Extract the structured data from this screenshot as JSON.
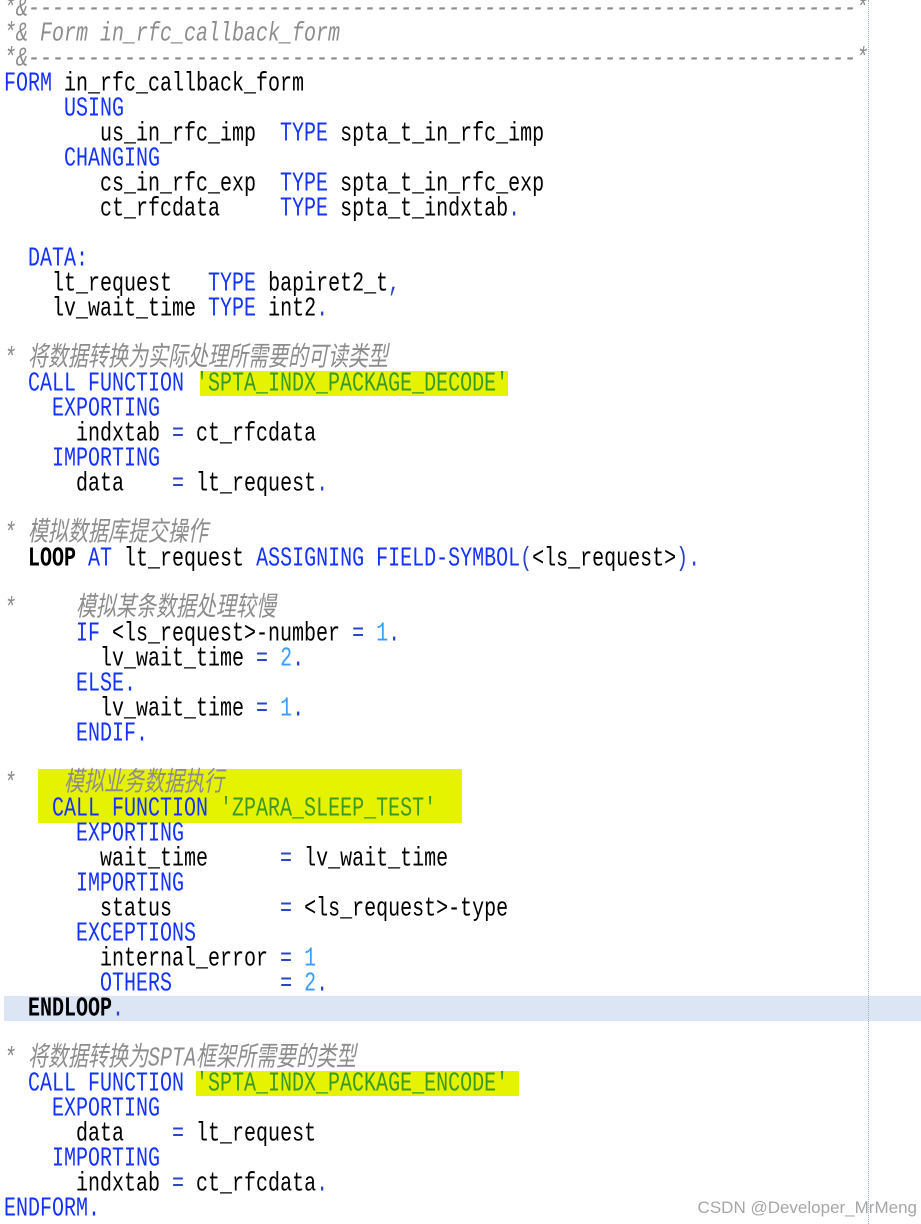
{
  "editor": {
    "current_line": 41,
    "lines": [
      [
        {
          "cm": "*&---------------------------------------------------------------------*"
        }
      ],
      [
        {
          "cm": "*& Form in_rfc_callback_form"
        }
      ],
      [
        {
          "cm": "*&---------------------------------------------------------------------*"
        }
      ],
      [
        {
          "kw": "FORM"
        },
        {
          "id": " in_rfc_callback_form"
        }
      ],
      [
        {
          "kw": "     USING"
        }
      ],
      [
        {
          "id": "        us_in_rfc_imp  "
        },
        {
          "kw": "TYPE"
        },
        {
          "id": " spta_t_in_rfc_imp"
        }
      ],
      [
        {
          "kw": "     CHANGING"
        }
      ],
      [
        {
          "id": "        cs_in_rfc_exp  "
        },
        {
          "kw": "TYPE"
        },
        {
          "id": " spta_t_in_rfc_exp"
        }
      ],
      [
        {
          "id": "        ct_rfcdata     "
        },
        {
          "kw": "TYPE"
        },
        {
          "id": " spta_t_indxtab"
        },
        {
          "op": "."
        }
      ],
      [],
      [
        {
          "kw": "  DATA:"
        }
      ],
      [
        {
          "id": "    lt_request   "
        },
        {
          "kw": "TYPE"
        },
        {
          "id": " bapiret2_t"
        },
        {
          "op": ","
        }
      ],
      [
        {
          "id": "    lv_wait_time "
        },
        {
          "kw": "TYPE"
        },
        {
          "id": " int2"
        },
        {
          "op": "."
        }
      ],
      [],
      [
        {
          "cm": "* 将数据转换为实际处理所需要的可读类型"
        }
      ],
      [
        {
          "kw": "  CALL FUNCTION "
        },
        {
          "str": "'SPTA_INDX_PACKAGE_DECODE'"
        }
      ],
      [
        {
          "kw": "    EXPORTING"
        }
      ],
      [
        {
          "id": "      indxtab "
        },
        {
          "op": "="
        },
        {
          "id": " ct_rfcdata"
        }
      ],
      [
        {
          "kw": "    IMPORTING"
        }
      ],
      [
        {
          "id": "      data    "
        },
        {
          "op": "="
        },
        {
          "id": " lt_request"
        },
        {
          "op": "."
        }
      ],
      [],
      [
        {
          "cm": "* 模拟数据库提交操作"
        }
      ],
      [
        {
          "blk": "  LOOP"
        },
        {
          "kw": " AT"
        },
        {
          "id": " lt_request "
        },
        {
          "kw": "ASSIGNING FIELD-SYMBOL"
        },
        {
          "op": "("
        },
        {
          "id": "<ls_request>"
        },
        {
          "op": ")"
        },
        {
          "op": "."
        }
      ],
      [],
      [
        {
          "cm": "*     模拟某条数据处理较慢"
        }
      ],
      [
        {
          "kw": "      IF"
        },
        {
          "id": " <ls_request>-number "
        },
        {
          "op": "="
        },
        {
          "num": " 1"
        },
        {
          "op": "."
        }
      ],
      [
        {
          "id": "        lv_wait_time "
        },
        {
          "op": "="
        },
        {
          "num": " 2"
        },
        {
          "op": "."
        }
      ],
      [
        {
          "kw": "      ELSE."
        }
      ],
      [
        {
          "id": "        lv_wait_time "
        },
        {
          "op": "="
        },
        {
          "num": " 1"
        },
        {
          "op": "."
        }
      ],
      [
        {
          "kw": "      ENDIF."
        }
      ],
      [],
      [
        {
          "cm": "*    模拟业务数据执行"
        }
      ],
      [
        {
          "kw": "    CALL FUNCTION "
        },
        {
          "str": "'ZPARA_SLEEP_TEST'"
        }
      ],
      [
        {
          "kw": "      EXPORTING"
        }
      ],
      [
        {
          "id": "        wait_time      "
        },
        {
          "op": "="
        },
        {
          "id": " lv_wait_time"
        }
      ],
      [
        {
          "kw": "      IMPORTING"
        }
      ],
      [
        {
          "id": "        status         "
        },
        {
          "op": "="
        },
        {
          "id": " <ls_request>-type"
        }
      ],
      [
        {
          "kw": "      EXCEPTIONS"
        }
      ],
      [
        {
          "id": "        internal_error "
        },
        {
          "op": "="
        },
        {
          "num": " 1"
        }
      ],
      [
        {
          "kw": "        OTHERS"
        },
        {
          "id": "         "
        },
        {
          "op": "="
        },
        {
          "num": " 2"
        },
        {
          "op": "."
        }
      ],
      [
        {
          "blk": "  ENDLOOP"
        },
        {
          "op": "."
        }
      ],
      [],
      [
        {
          "cm": "* 将数据转换为SPTA框架所需要的类型"
        }
      ],
      [
        {
          "kw": "  CALL FUNCTION "
        },
        {
          "str": "'SPTA_INDX_PACKAGE_ENCODE'"
        }
      ],
      [
        {
          "kw": "    EXPORTING"
        }
      ],
      [
        {
          "id": "      data    "
        },
        {
          "op": "="
        },
        {
          "id": " lt_request"
        }
      ],
      [
        {
          "kw": "    IMPORTING"
        }
      ],
      [
        {
          "id": "      indxtab "
        },
        {
          "op": "="
        },
        {
          "id": " ct_rfcdata"
        },
        {
          "op": "."
        }
      ],
      [
        {
          "kw": "ENDFORM."
        }
      ]
    ]
  },
  "watermark": "CSDN @Developer_MrMeng",
  "colors": {
    "background": "#ffffff",
    "keyword": "#1432ff",
    "identifier": "#000000",
    "comment": "#8c8c8c",
    "string_literal": "#3a9a26",
    "number": "#3c9dff",
    "operator": "#2b45c9",
    "block_keyword": "#000000",
    "highlight": "#e6f300",
    "current_line": "#dbe5f3",
    "margin_line": "#98b6c9",
    "watermark": "#a6a6a6"
  }
}
